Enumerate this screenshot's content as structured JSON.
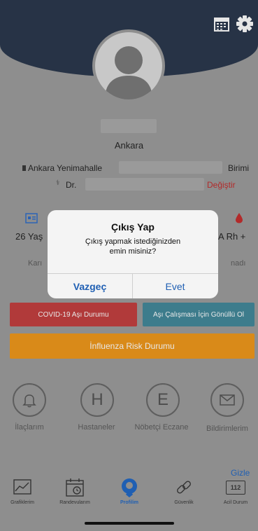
{
  "profile": {
    "city": "Ankara"
  },
  "info": {
    "hospital_prefix": "Ankara Yenimahalle",
    "hospital_suffix": "Birimi",
    "doctor_prefix": "Dr.",
    "change_link": "Değiştir"
  },
  "stats": {
    "age_value": "26 Yaş",
    "blood_value": "A Rh +",
    "left_label": "Karı",
    "right_label": "nadı"
  },
  "buttons": {
    "covid": "COVID-19 Aşı Durumu",
    "volunteer": "Aşı Çalışması İçin Gönüllü Ol",
    "influenza": "İnfluenza Risk Durumu"
  },
  "quick_actions": [
    {
      "letter": "",
      "label": "İlaçlarım"
    },
    {
      "letter": "H",
      "label": "Hastaneler"
    },
    {
      "letter": "E",
      "label": "Nöbetçi Eczane"
    },
    {
      "letter": "",
      "label": "Bildirimlerim"
    }
  ],
  "hide_link": "Gizle",
  "tabs": [
    {
      "label": "Grafiklerim",
      "icon": "chart-icon"
    },
    {
      "label": "Randevularım",
      "icon": "calendar-clock-icon"
    },
    {
      "label": "Profilim",
      "icon": "profile-icon"
    },
    {
      "label": "Güvenlik",
      "icon": "link-icon"
    },
    {
      "label": "Acil Durum",
      "icon": "112-icon",
      "badge": "112"
    }
  ],
  "dialog": {
    "title": "Çıkış Yap",
    "message": "Çıkış yapmak istediğinizden emin misiniz?",
    "cancel": "Vazgeç",
    "confirm": "Evet"
  },
  "colors": {
    "header": "#273346",
    "covid_button": "#b13a3a",
    "volunteer_button": "#3d7c8c",
    "influenza_button": "#d98a19",
    "active_tab": "#1f5fb3",
    "dialog_action": "#1f5fb3"
  }
}
